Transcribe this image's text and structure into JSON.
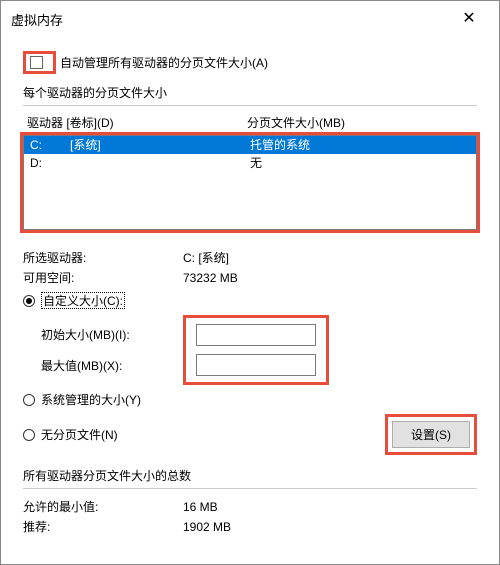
{
  "title": "虚拟内存",
  "auto_manage_label": "自动管理所有驱动器的分页文件大小(A)",
  "per_drive_label": "每个驱动器的分页文件大小",
  "drive_header": "驱动器 [卷标](D)",
  "size_header": "分页文件大小(MB)",
  "drives": [
    {
      "letter": "C:",
      "vol": "[系统]",
      "size": "托管的系统"
    },
    {
      "letter": "D:",
      "vol": "",
      "size": "无"
    }
  ],
  "selected_drive_label": "所选驱动器:",
  "selected_drive_value": "C:  [系统]",
  "avail_label": "可用空间:",
  "avail_value": "73232 MB",
  "custom_size_label": "自定义大小(C):",
  "initial_label": "初始大小(MB)(I):",
  "max_label": "最大值(MB)(X):",
  "initial_value": "",
  "max_value": "",
  "sys_managed_label": "系统管理的大小(Y)",
  "no_paging_label": "无分页文件(N)",
  "set_button": "设置(S)",
  "totals_label": "所有驱动器分页文件大小的总数",
  "min_allowed_label": "允许的最小值:",
  "min_allowed_value": "16 MB",
  "recommended_label": "推荐:",
  "recommended_value": "1902 MB"
}
